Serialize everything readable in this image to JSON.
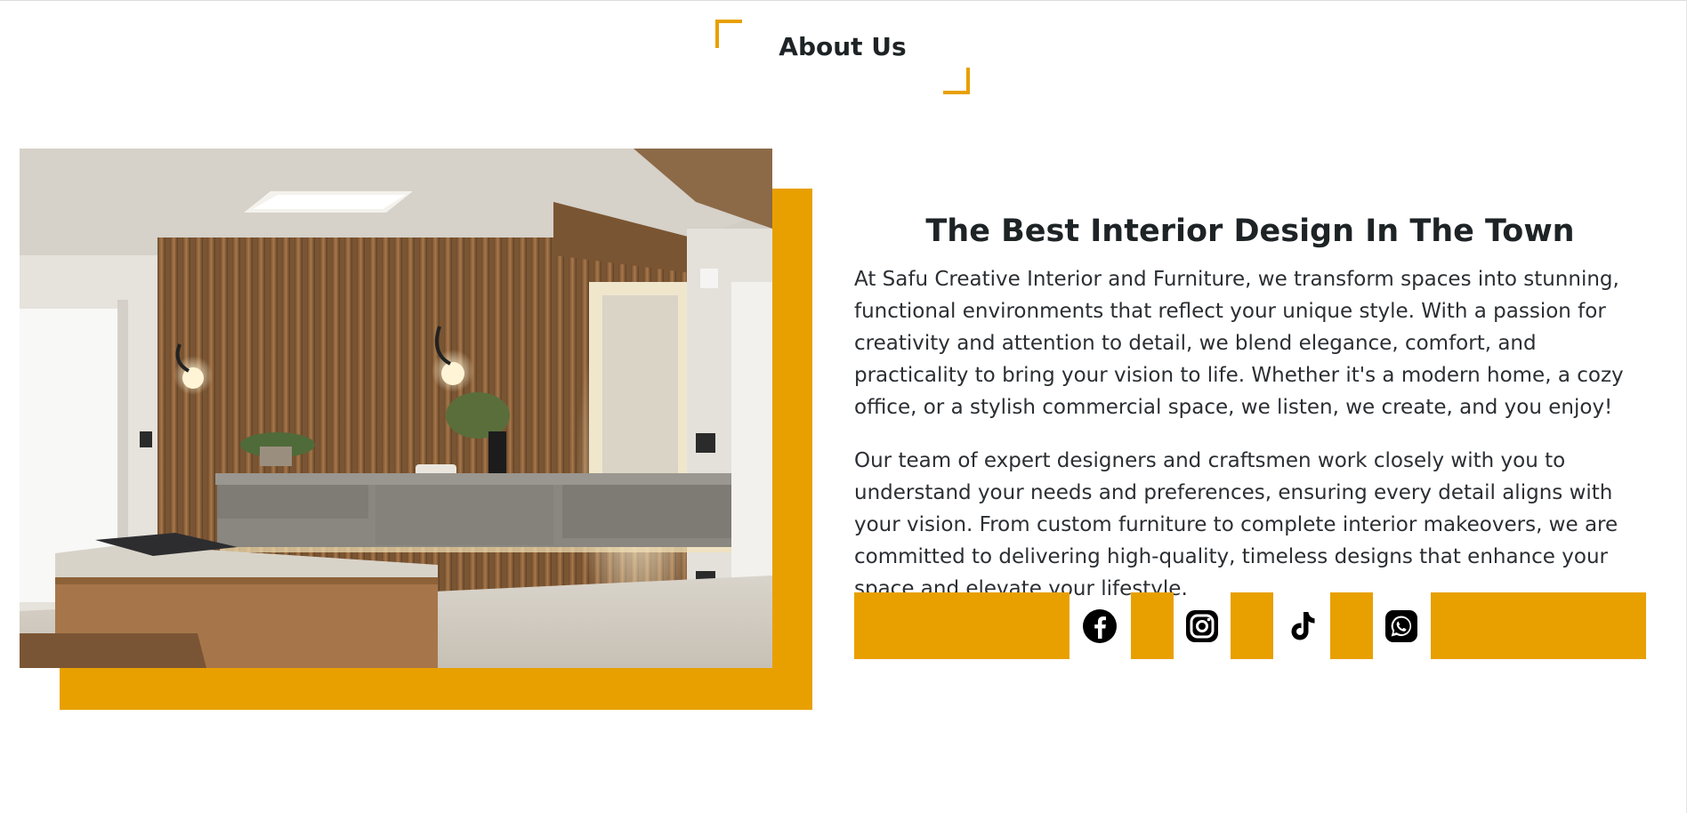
{
  "section": {
    "title": "About Us"
  },
  "about": {
    "image_alt": "Interior with slatted wood wall, floating vanity and bench",
    "heading": "The Best Interior Design In The Town",
    "paragraph1": "At Safu Creative Interior and Furniture, we transform spaces into stunning, functional environments that reflect your unique style. With a passion for creativity and attention to detail, we blend elegance, comfort, and practicality to bring your vision to life. Whether it's a modern home, a cozy office, or a stylish commercial space, we listen, we create, and you enjoy!",
    "paragraph2": "Our team of expert designers and craftsmen work closely with you to understand your needs and preferences, ensuring every detail aligns with your vision. From custom furniture to complete interior makeovers, we are committed to delivering high-quality, timeless designs that enhance your space and elevate your lifestyle."
  },
  "social": {
    "icons": [
      "facebook-icon",
      "instagram-icon",
      "tiktok-icon",
      "whatsapp-icon"
    ]
  },
  "colors": {
    "accent": "#e8a000",
    "text": "#212529"
  }
}
